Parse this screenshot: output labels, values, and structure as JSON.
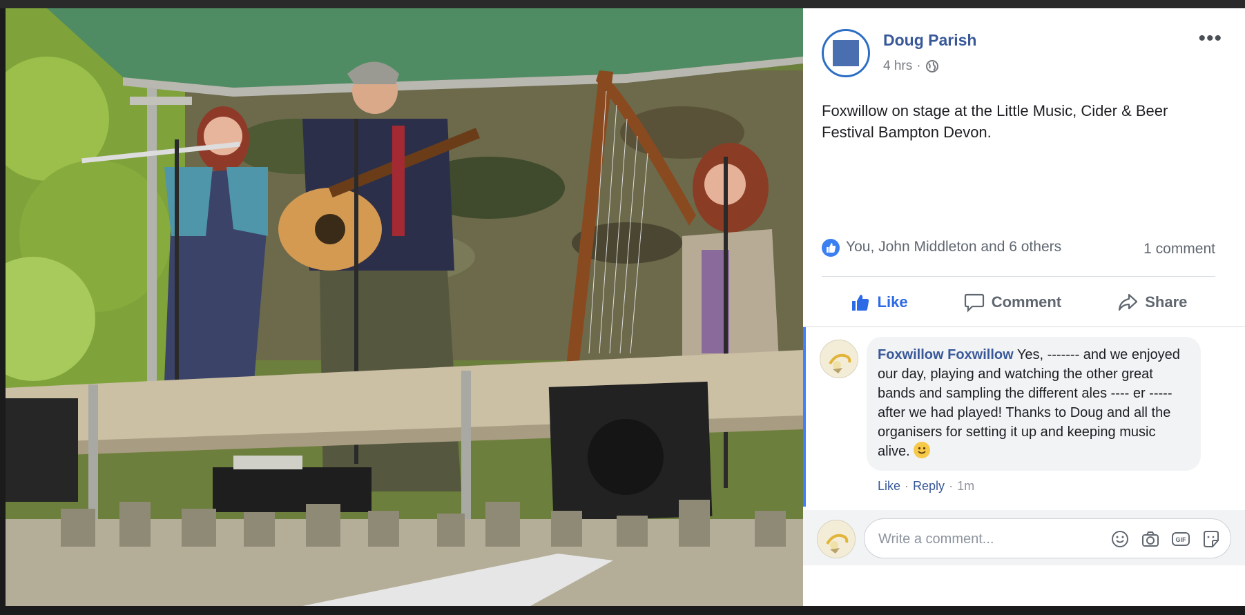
{
  "post": {
    "author": "Doug Parish",
    "time": "4 hrs",
    "separator": "·",
    "more_label": "•••",
    "text": "Foxwillow on stage at the Little Music, Cider & Beer Festival Bampton Devon."
  },
  "reactions": {
    "names": "You, John Middleton and 6 others",
    "comment_count": "1 comment"
  },
  "actions": {
    "like": "Like",
    "comment": "Comment",
    "share": "Share"
  },
  "comment": {
    "author": "Foxwillow Foxwillow",
    "text": " Yes, ------- and we enjoyed our day, playing and watching the other great bands and sampling the different ales ---- er ----- after we had played! Thanks to Doug and all the organisers for setting it up and keeping music alive. ",
    "like": "Like",
    "reply": "Reply",
    "sep": "·",
    "time": "1m"
  },
  "composer": {
    "placeholder": "Write a comment..."
  },
  "icons": {
    "privacy": "globe-icon",
    "reaction": "thumbs-up-icon",
    "camera": "camera-icon",
    "gif": "gif-icon",
    "sticker": "sticker-icon",
    "emoji": "smiley-icon"
  },
  "colors": {
    "link": "#385898",
    "accent": "#2d6ae6",
    "muted": "#606770"
  }
}
